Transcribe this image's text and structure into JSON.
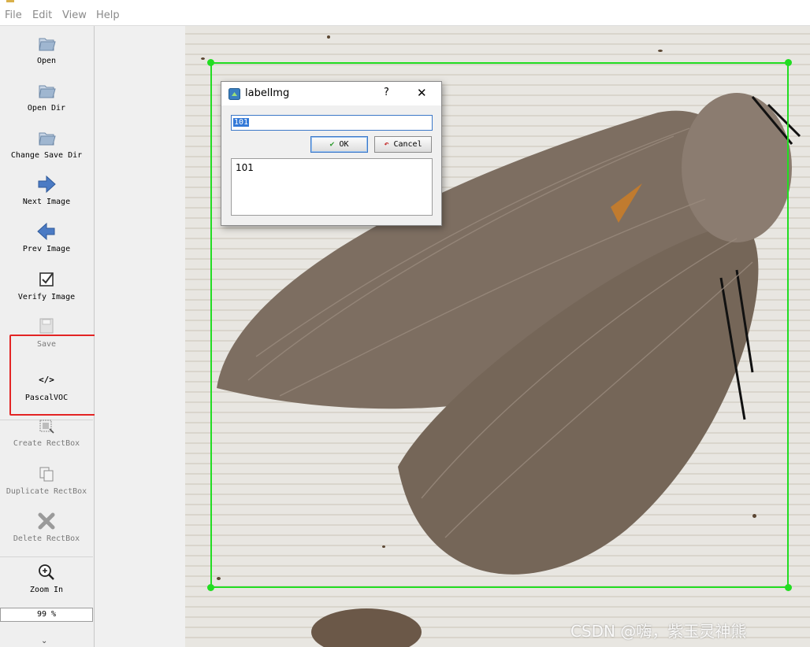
{
  "menu": {
    "file": "File",
    "edit": "Edit",
    "view": "View",
    "help": "Help"
  },
  "toolbar": {
    "open": "Open",
    "open_dir": "Open Dir",
    "change_save_dir": "Change Save Dir",
    "next_image": "Next Image",
    "prev_image": "Prev Image",
    "verify_image": "Verify Image",
    "save": "Save",
    "format_icon": "</>",
    "format": "PascalVOC",
    "create_rectbox": "Create RectBox",
    "duplicate_rectbox": "Duplicate RectBox",
    "delete_rectbox": "Delete RectBox",
    "zoom_in": "Zoom In",
    "zoom_value": "99 %",
    "more": "⌄"
  },
  "dialog": {
    "title": "labelImg",
    "help": "?",
    "close": "✕",
    "input_value": "101",
    "ok_label": "OK",
    "cancel_label": "Cancel",
    "list_items": [
      "101"
    ]
  },
  "colors": {
    "bbox": "#22dd22",
    "highlight_box": "#e32424",
    "selection": "#3379d8"
  },
  "icons": {
    "open": "folder-icon",
    "open_dir": "folder-icon",
    "change_save_dir": "folder-icon",
    "next_image": "arrow-right-icon",
    "prev_image": "arrow-left-icon",
    "verify_image": "checkbox-icon",
    "save": "save-icon",
    "create_rectbox": "rectbox-icon",
    "duplicate_rectbox": "duplicate-icon",
    "delete_rectbox": "delete-icon",
    "zoom_in": "zoom-in-icon"
  },
  "watermark": "CSDN @嗨，紫玉灵神熊"
}
